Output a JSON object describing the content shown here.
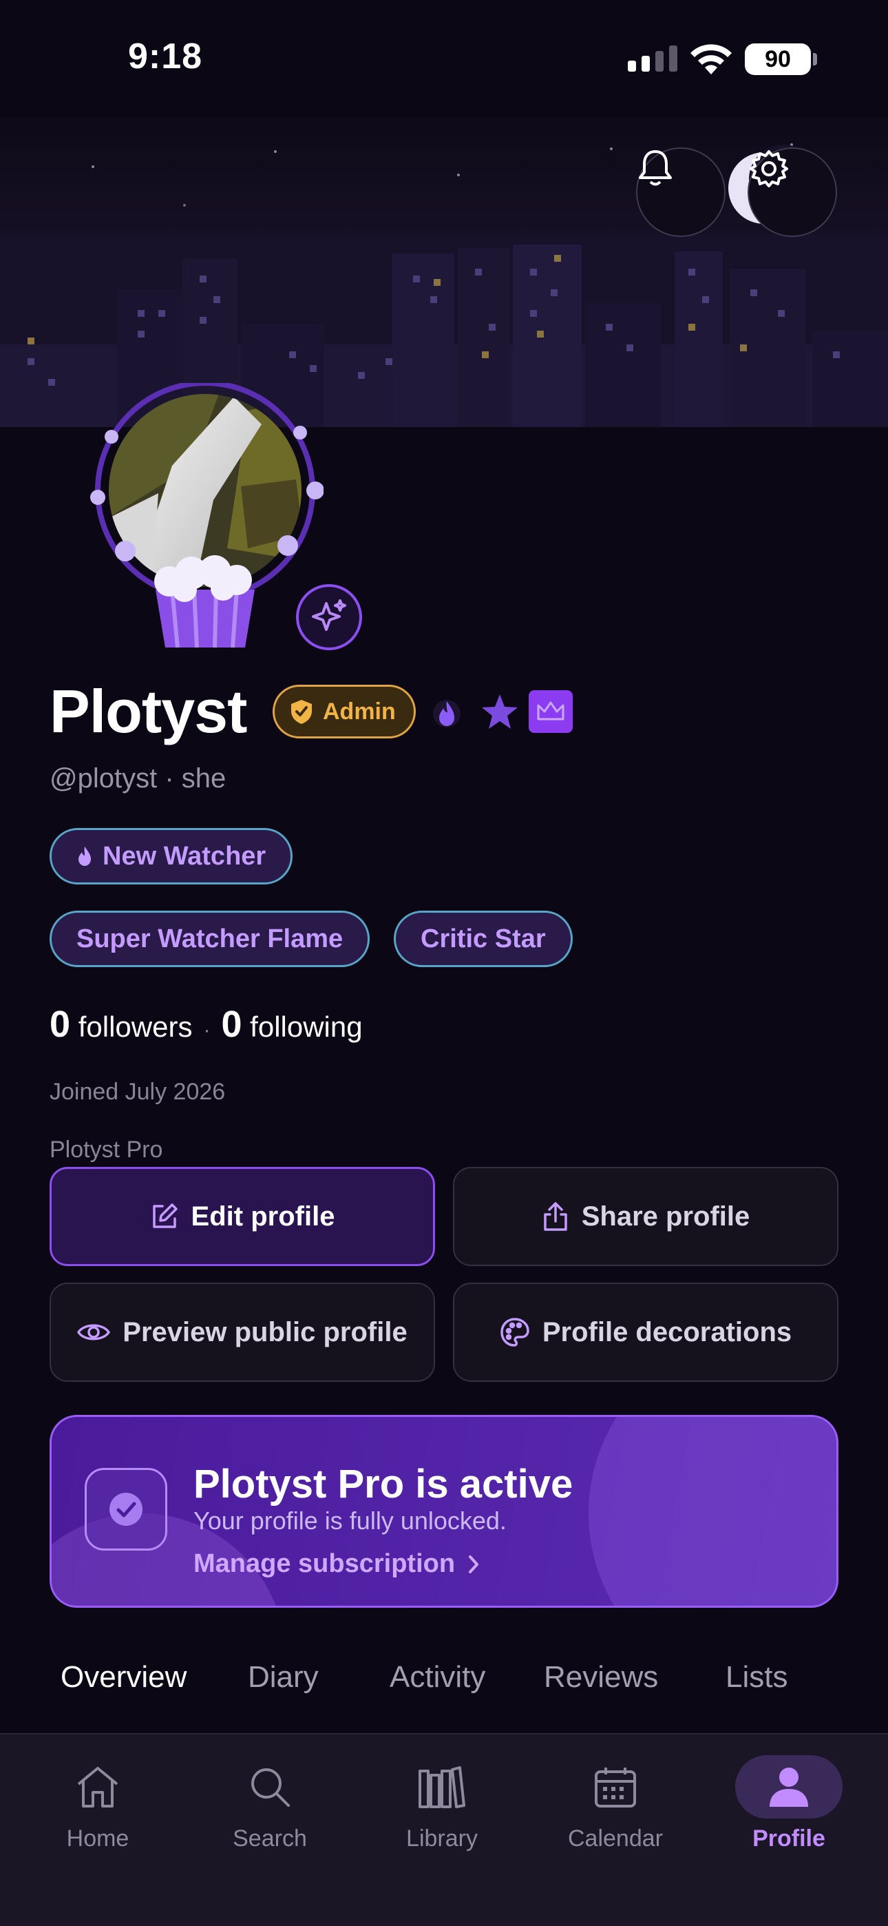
{
  "status_bar": {
    "time": "9:18",
    "battery": "90"
  },
  "profile": {
    "display_name": "Plotyst",
    "admin_badge": "Admin",
    "handle": "@plotyst",
    "pronouns": "she",
    "chips": [
      "New Watcher",
      "Super Watcher Flame",
      "Critic Star"
    ],
    "followers_count": "0",
    "followers_label": "followers",
    "following_count": "0",
    "following_label": "following",
    "joined": "Joined July 2026",
    "plan_label": "Plotyst Pro"
  },
  "actions": {
    "edit": "Edit profile",
    "share": "Share profile",
    "preview": "Preview public profile",
    "decorations": "Profile decorations"
  },
  "pro_card": {
    "title": "Plotyst Pro is active",
    "subtitle": "Your profile is fully unlocked.",
    "manage": "Manage subscription"
  },
  "tabs": [
    "Overview",
    "Diary",
    "Activity",
    "Reviews",
    "Lists"
  ],
  "active_tab": "Overview",
  "bottom_nav": {
    "items": [
      "Home",
      "Search",
      "Library",
      "Calendar",
      "Profile"
    ],
    "active": "Profile"
  },
  "colors": {
    "background": "#0b0714",
    "accent": "#8b4ff0",
    "admin": "#f2b445",
    "chip_text": "#c49bff"
  },
  "icons": [
    "bell-icon",
    "gear-icon",
    "sparkle-icon",
    "shield-icon",
    "flame-icon",
    "star-icon",
    "crown-icon",
    "edit-icon",
    "share-icon",
    "eye-icon",
    "palette-icon",
    "check-icon",
    "chevron-right-icon",
    "home-icon",
    "search-icon",
    "library-icon",
    "calendar-icon",
    "person-icon"
  ]
}
